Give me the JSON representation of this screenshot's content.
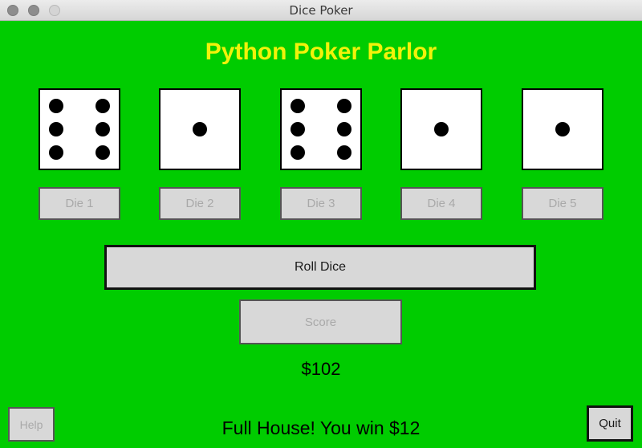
{
  "window": {
    "title": "Dice Poker"
  },
  "heading": "Python Poker Parlor",
  "dice": [
    {
      "value": 6,
      "button_label": "Die 1"
    },
    {
      "value": 1,
      "button_label": "Die 2"
    },
    {
      "value": 6,
      "button_label": "Die 3"
    },
    {
      "value": 1,
      "button_label": "Die 4"
    },
    {
      "value": 1,
      "button_label": "Die 5"
    }
  ],
  "buttons": {
    "roll_label": "Roll Dice",
    "score_label": "Score",
    "help_label": "Help",
    "quit_label": "Quit"
  },
  "money": "$102",
  "message": "Full House! You win $12",
  "colors": {
    "background": "#00cc00",
    "heading": "#f2f20a",
    "button_face": "#d8d8d8"
  }
}
